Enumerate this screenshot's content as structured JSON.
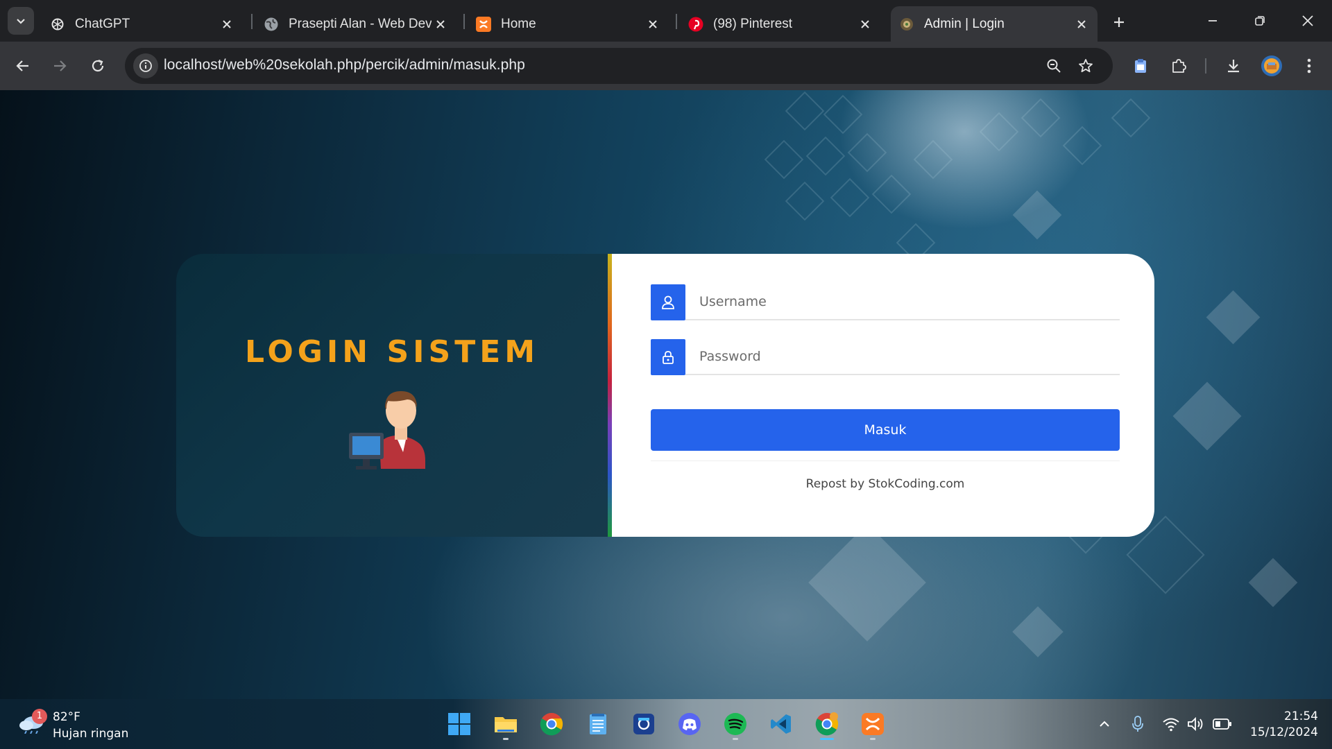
{
  "browser": {
    "tabs": [
      {
        "title": "ChatGPT",
        "icon": "chatgpt-icon"
      },
      {
        "title": "Prasepti Alan - Web Deve",
        "icon": "globe-icon"
      },
      {
        "title": "Home",
        "icon": "xampp-icon"
      },
      {
        "title": "(98) Pinterest",
        "icon": "pinterest-icon"
      },
      {
        "title": "Admin | Login",
        "icon": "site-icon",
        "active": true
      }
    ],
    "url": "localhost/web%20sekolah.php/percik/admin/masuk.php"
  },
  "login": {
    "heading": "LOGIN SISTEM",
    "username_placeholder": "Username",
    "password_placeholder": "Password",
    "submit_label": "Masuk",
    "credit": "Repost by StokCoding.com",
    "accent_color": "#2563eb",
    "heading_color": "#f4a21b"
  },
  "taskbar": {
    "weather_badge": "1",
    "weather_temp": "82°F",
    "weather_condition": "Hujan ringan",
    "time": "21:54",
    "date": "15/12/2024",
    "apps": [
      "windows-start-icon",
      "file-explorer-icon",
      "chrome-icon",
      "notepad-icon",
      "snipping-tool-icon",
      "discord-icon",
      "spotify-icon",
      "vscode-icon",
      "chrome-profile-icon",
      "xampp-icon"
    ]
  }
}
